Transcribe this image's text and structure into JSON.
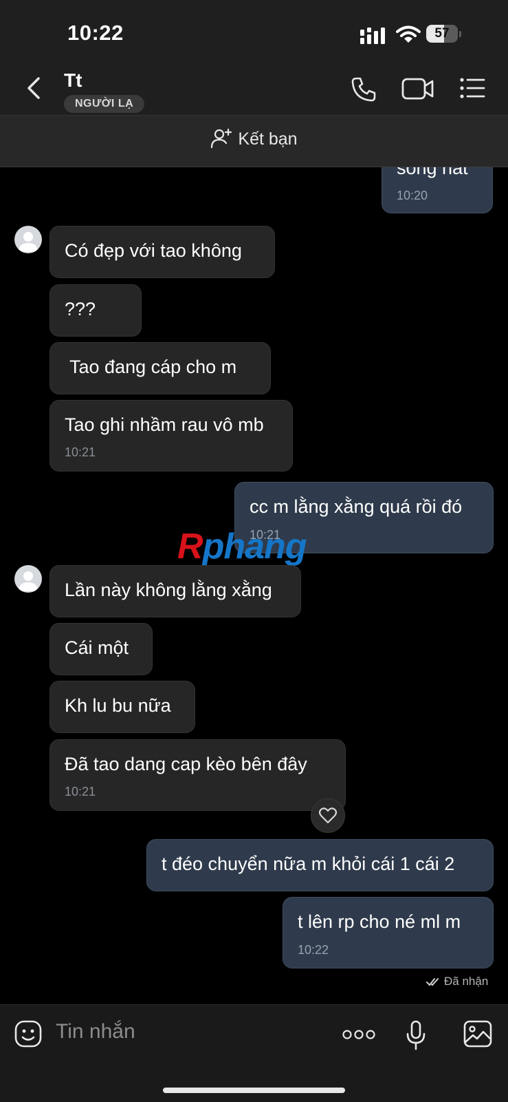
{
  "status_bar": {
    "time": "10:22",
    "battery": "57",
    "battery_level": 0.57
  },
  "header": {
    "contact_name": "Tt",
    "badge": "NGƯỜI LẠ"
  },
  "add_friend": {
    "label": "Kết bạn"
  },
  "messages": [
    {
      "side": "out",
      "text": "sống nát",
      "time": "10:20"
    },
    {
      "side": "in",
      "text": "Có đẹp với tao không"
    },
    {
      "side": "in",
      "text": "???"
    },
    {
      "side": "in",
      "text": " Tao đang cáp cho m"
    },
    {
      "side": "in",
      "text": "Tao ghi nhầm rau vô mb",
      "time": "10:21"
    },
    {
      "side": "out",
      "text": "cc m lằng xằng quá rồi đó",
      "time": "10:21"
    },
    {
      "side": "in",
      "text": "Lần này không lằng xằng"
    },
    {
      "side": "in",
      "text": "Cái một"
    },
    {
      "side": "in",
      "text": "Kh lu bu nữa"
    },
    {
      "side": "in",
      "text": "Đã tao dang cap kèo bên đây",
      "time": "10:21"
    },
    {
      "side": "out",
      "text": "t đéo chuyển nữa m khỏi cái 1 cái 2"
    },
    {
      "side": "out",
      "text": "t lên rp cho né ml m",
      "time": "10:22"
    }
  ],
  "watermark": {
    "first": "R",
    "rest": "phang"
  },
  "delivery_status": "Đã nhận",
  "composer": {
    "placeholder": "Tin nhắn"
  },
  "colors": {
    "incoming_bubble": "#262626",
    "outgoing_bubble": "#2f3b4c",
    "background": "#000000"
  }
}
